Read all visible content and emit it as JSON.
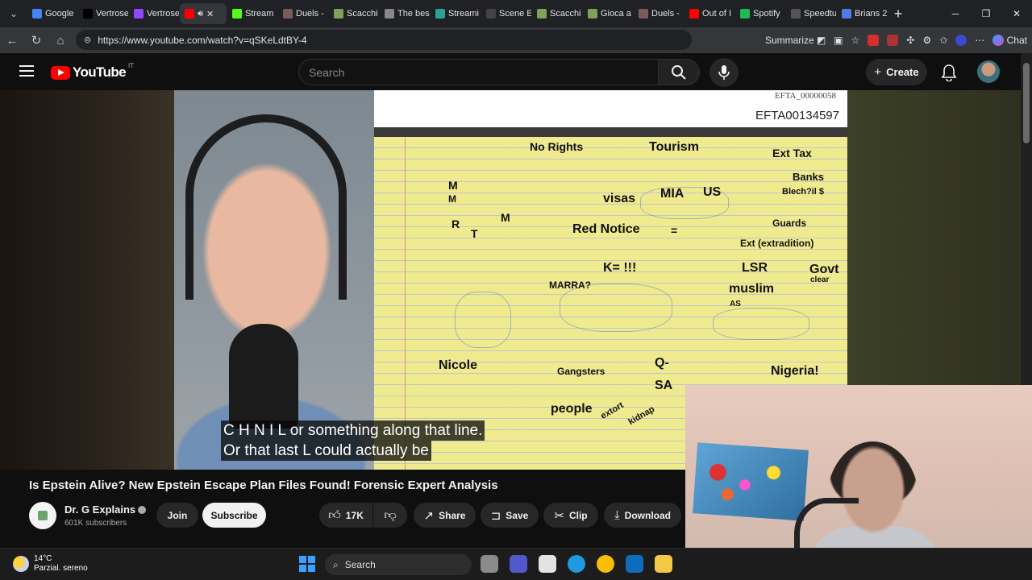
{
  "browser": {
    "tabs": [
      {
        "label": "Google",
        "color": "#4285f4"
      },
      {
        "label": "Vertrose",
        "color": "#000000"
      },
      {
        "label": "Vertrose",
        "color": "#9146ff"
      },
      {
        "label": "",
        "color": "#ff0000",
        "active": true
      },
      {
        "label": "Stream",
        "color": "#53fc18"
      },
      {
        "label": "Duels -",
        "color": "#7a5c5c"
      },
      {
        "label": "Scacchi",
        "color": "#7da35a"
      },
      {
        "label": "The bes",
        "color": "#888888"
      },
      {
        "label": "Streami",
        "color": "#2aa198"
      },
      {
        "label": "Scene E",
        "color": "#444444"
      },
      {
        "label": "Scacchi",
        "color": "#7da35a"
      },
      {
        "label": "Gioca a",
        "color": "#7da35a"
      },
      {
        "label": "Duels -",
        "color": "#7a5c5c"
      },
      {
        "label": "Out of I",
        "color": "#ff0000"
      },
      {
        "label": "Spotify",
        "color": "#1db954"
      },
      {
        "label": "Speedtu",
        "color": "#555555"
      },
      {
        "label": "Brians 2",
        "color": "#4e7be8"
      }
    ],
    "url": "https://www.youtube.com/watch?v=qSKeLdtBY-4",
    "summarize_label": "Summarize",
    "chat_label": "Chat"
  },
  "youtube": {
    "logo_text": "YouTube",
    "country_code": "IT",
    "search_placeholder": "Search",
    "create_label": "Create"
  },
  "video": {
    "doc_id_small": "EFTA_00000058",
    "doc_id": "EFTA00134597",
    "note_words": [
      "No Rights",
      "Tourism",
      "Ext Tax",
      "Banks",
      "Blech?il $",
      "M",
      "M",
      "visas",
      "MIA",
      "US",
      "R",
      "T",
      "M",
      "Red Notice",
      "=",
      "Guards",
      "Ext (extradition)",
      "LSR",
      "Govt",
      "clear",
      "K= !!!",
      "muslim",
      "MARRA?",
      "AS",
      "Nicole",
      "Gangsters",
      "Q-",
      "SA",
      "Nigeria!",
      "people",
      "extort",
      "kidnap"
    ],
    "caption_line1": "C H N I L or something along that line.",
    "caption_line2": "Or that last L could actually be"
  },
  "meta": {
    "title": "Is Epstein Alive? New Epstein Escape Plan Files Found! Forensic Expert Analysis",
    "channel_name": "Dr. G Explains",
    "subscribers": "601K subscribers",
    "join_label": "Join",
    "subscribe_label": "Subscribe",
    "likes": "17K",
    "share_label": "Share",
    "save_label": "Save",
    "clip_label": "Clip",
    "download_label": "Download"
  },
  "taskbar": {
    "temperature": "14°C",
    "weather_desc": "Parzial. sereno",
    "search_label": "Search",
    "app_colors": [
      "#8a8a8a",
      "#5059c9",
      "#e3e3e3",
      "#1f9ae0",
      "#fbbc04",
      "#0f6cbd",
      "#f3c844"
    ]
  }
}
